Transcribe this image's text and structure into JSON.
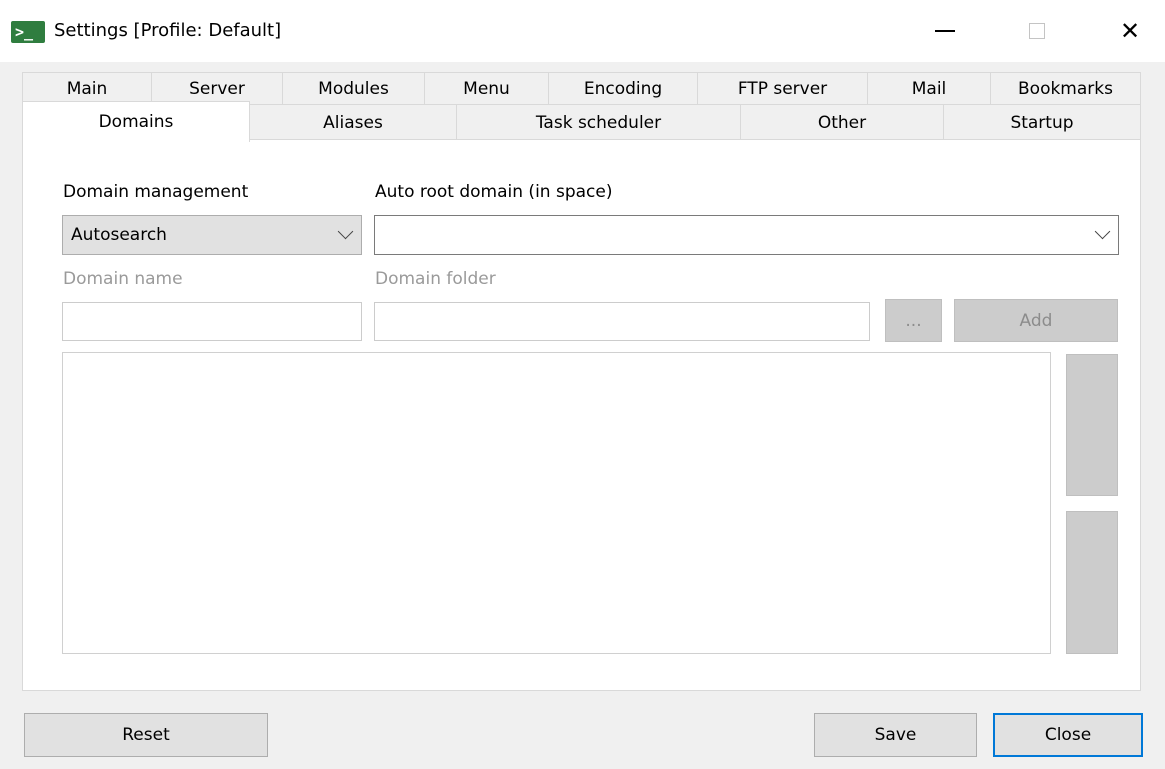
{
  "window": {
    "title": "Settings [Profile: Default]",
    "icon_glyph": ">_",
    "icon": "terminal-icon"
  },
  "tabs": {
    "row1": [
      "Main",
      "Server",
      "Modules",
      "Menu",
      "Encoding",
      "FTP server",
      "Mail",
      "Bookmarks"
    ],
    "row2": [
      "Domains",
      "Aliases",
      "Task scheduler",
      "Other",
      "Startup"
    ],
    "active": "Domains"
  },
  "domains": {
    "domain_management_label": "Domain management",
    "domain_management_value": "Autosearch",
    "auto_root_label": "Auto root domain (in space)",
    "auto_root_value": "",
    "domain_name_label": "Domain name",
    "domain_name_value": "",
    "domain_folder_label": "Domain folder",
    "domain_folder_value": "",
    "browse_label": "...",
    "add_label": "Add",
    "domain_list": []
  },
  "footer": {
    "reset_label": "Reset",
    "save_label": "Save",
    "close_label": "Close"
  },
  "colors": {
    "accent": "#0078d7",
    "icon_green": "#2f7d3f"
  }
}
